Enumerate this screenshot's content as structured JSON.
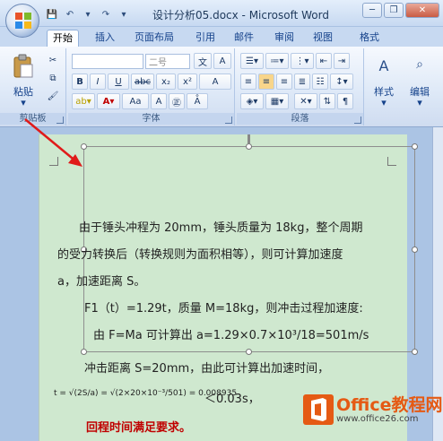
{
  "window": {
    "title": "设计分析05.docx - Microsoft Word",
    "minimize": "─",
    "restore": "❐",
    "close": "✕"
  },
  "tabs": [
    "开始",
    "插入",
    "页面布局",
    "引用",
    "邮件",
    "审阅",
    "视图",
    "格式"
  ],
  "ribbon": {
    "clipboard": {
      "label": "剪贴板",
      "paste": "粘贴"
    },
    "font": {
      "label": "字体",
      "font_size": "二号",
      "bold": "B",
      "italic": "I",
      "underline": "U",
      "strike": "abc",
      "sub": "x₂",
      "sup": "x²",
      "aa": "Aa",
      "wen": "文",
      "clear": "A"
    },
    "paragraph": {
      "label": "段落"
    },
    "styles": {
      "label": "样式"
    },
    "editing": {
      "label": "编辑"
    }
  },
  "document": {
    "line1": "由于锤头冲程为 20mm，锤头质量为 18kg，整个周期",
    "line2": "的受力转换后（转换规则为面积相等），则可计算加速度",
    "line3": "a，加速距离 S。",
    "line4": "F1（t）=1.29t，质量 M=18kg，则冲击过程加速度:",
    "line5": "由 F=Ma    可计算出 a=1.29×0.7×10³/18=501m/s",
    "line6": "冲击距离  S=20mm，由此可计算出加速时间，",
    "formula": "t = √(2S/a) = √(2×20×10⁻³/501) = 0.008935",
    "formula_tail": "＜0.03s，",
    "line8": "回程时间满足要求。"
  },
  "watermark": {
    "name": "Office教程网",
    "url": "www.office26.com"
  },
  "colors": {
    "accent_red": "#c00000",
    "page_green": "#cfe8cf",
    "brand_orange": "#e55a14"
  }
}
